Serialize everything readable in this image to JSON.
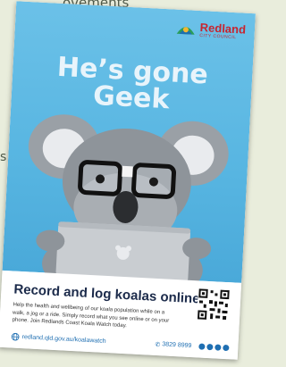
{
  "background": {
    "top_text": "ovements",
    "side_text": "s"
  },
  "poster": {
    "logo": {
      "name": "Redland",
      "sub": "CITY COUNCIL"
    },
    "headline": {
      "line1": "He’s gone",
      "line2": "Geek"
    },
    "tagline": "Record and log koalas online",
    "body": "Help the health and wellbeing of our koala population while on a walk, a jog or a ride. Simply record what you see online or on your phone. Join Redlands Coast Koala Watch today.",
    "website": "redland.qld.gov.au/koalawatch",
    "phone": "3829 8999"
  },
  "colors": {
    "sky": "#57b5e1",
    "brand_red": "#c8242f",
    "link_blue": "#1f6fb2",
    "backdrop": "#e9eddc"
  }
}
